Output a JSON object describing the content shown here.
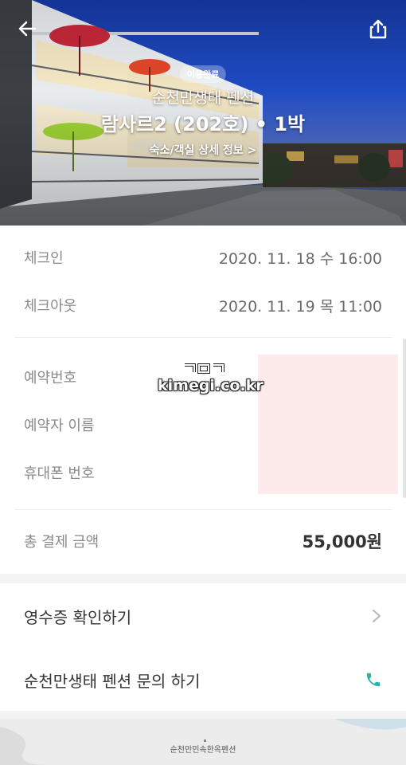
{
  "hero": {
    "status": "이용완료",
    "pension_name": "순천만생태 펜션",
    "room_name": "람사르2 (202호) • 1박",
    "detail_link": "숙소/객실 상세 정보 >"
  },
  "stay": {
    "checkin_label": "체크인",
    "checkin_value": "2020. 11. 18 수 16:00",
    "checkout_label": "체크아웃",
    "checkout_value": "2020. 11. 19 목 11:00"
  },
  "reservation": {
    "number_label": "예약번호",
    "name_label": "예약자 이름",
    "phone_label": "휴대폰 번호"
  },
  "watermark": {
    "text": "kimegi.co.kr"
  },
  "payment": {
    "total_label": "총 결제 금액",
    "total_value": "55,000원"
  },
  "actions": {
    "receipt": "영수증 확인하기",
    "inquiry": "순천만생태 펜션 문의 하기"
  },
  "map": {
    "label": "순천만민속한옥펜션"
  },
  "colors": {
    "accent_teal": "#2bb3a8",
    "redaction": "#fdeaea"
  }
}
